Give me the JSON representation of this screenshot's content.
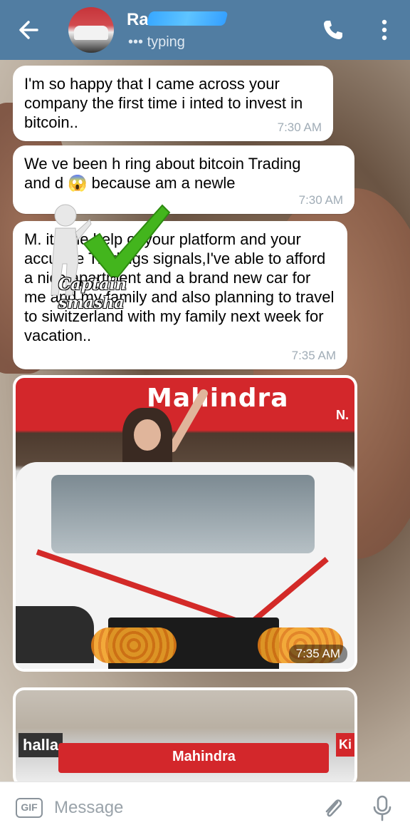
{
  "header": {
    "contact_name": "Ra",
    "status": "••• typing",
    "colors": {
      "bar": "#517da2",
      "text": "#ffffff"
    },
    "icons": [
      "back-arrow-icon",
      "phone-icon",
      "more-vert-icon"
    ]
  },
  "messages": [
    {
      "text": "I'm so happy that I came across your company the first time i inted to invest in bitcoin..",
      "time": "7:30 AM"
    },
    {
      "text": "We    ve been h     ring about bitcoin Trading\nand              d 😱 because am a newle",
      "time": "7:30 AM"
    },
    {
      "text": "M.              ith the help of your platform and your accurate Tradings signals,I've able to afford a nice apartment and a brand new car for me and my family and also planning to travel to siwitzerland with my family next week for vacation..",
      "time": "7:35 AM"
    }
  ],
  "photos": [
    {
      "brand": "Mahindra",
      "brand_suffix": "N.",
      "time": "7:35 AM"
    },
    {
      "sign": "Mahindra",
      "left_sign": "halla",
      "right_sign": "Ki"
    }
  ],
  "watermark": {
    "text": "Captain smasha"
  },
  "input": {
    "placeholder": "Message",
    "gif_label": "GIF",
    "icons": [
      "attach-icon",
      "mic-icon"
    ]
  }
}
